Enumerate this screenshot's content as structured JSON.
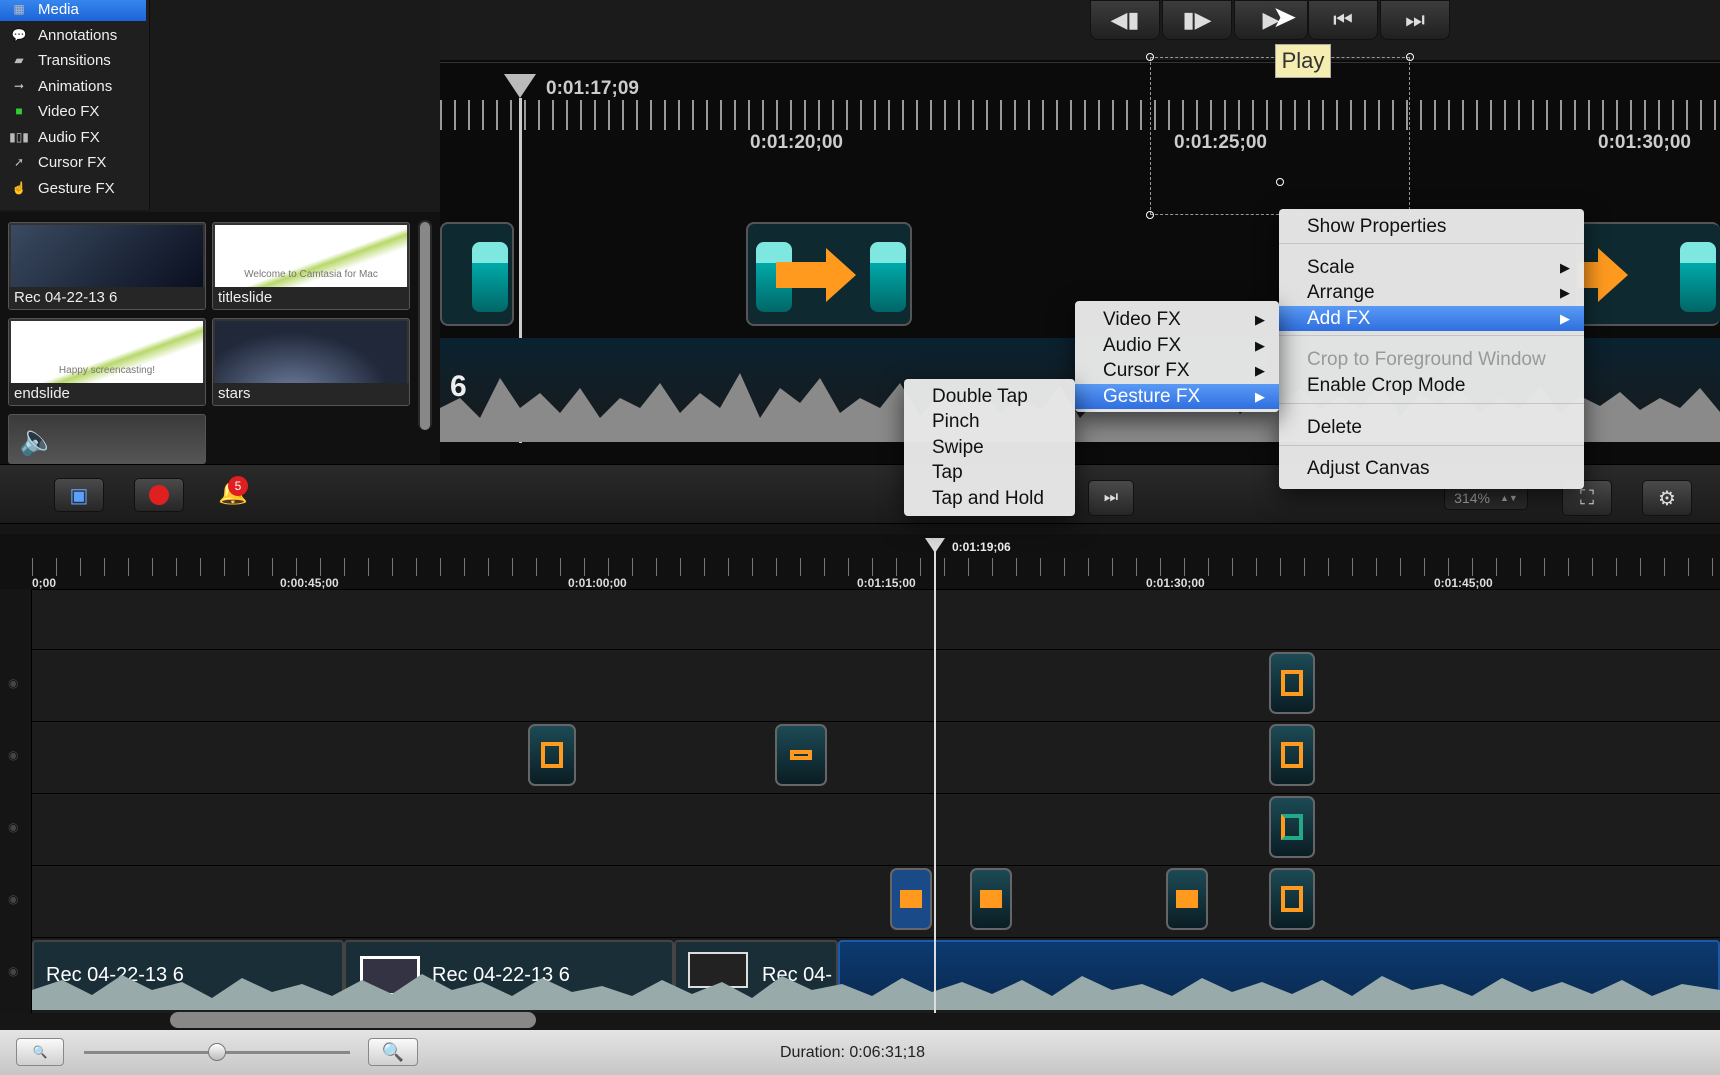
{
  "library": {
    "items": [
      {
        "label": "Media",
        "icon": "media-icon"
      },
      {
        "label": "Annotations",
        "icon": "annotations-icon"
      },
      {
        "label": "Transitions",
        "icon": "transitions-icon"
      },
      {
        "label": "Animations",
        "icon": "animations-icon"
      },
      {
        "label": "Video FX",
        "icon": "video-fx-icon"
      },
      {
        "label": "Audio FX",
        "icon": "audio-fx-icon"
      },
      {
        "label": "Cursor FX",
        "icon": "cursor-fx-icon"
      },
      {
        "label": "Gesture FX",
        "icon": "gesture-fx-icon"
      }
    ],
    "selected": "Media"
  },
  "bin": {
    "clips": [
      {
        "label": "Rec 04-22-13 6"
      },
      {
        "label": "titleslide",
        "text": "Welcome to Camtasia for Mac"
      },
      {
        "label": "endslide",
        "text": "Happy screencasting!"
      },
      {
        "label": "stars"
      }
    ]
  },
  "canvas": {
    "playhead_time": "0:01:17;09",
    "ruler_labels": [
      "0:01:20;00",
      "0:01:25;00",
      "0:01:30;00"
    ],
    "track_number": "6",
    "tooltip": "Play"
  },
  "toolbar": {
    "notification_count": "5",
    "zoom": "314%"
  },
  "context_menu": {
    "items": [
      {
        "label": "Show Properties"
      },
      {
        "label": "Scale",
        "sub": "▶"
      },
      {
        "label": "Arrange",
        "sub": "▶"
      },
      {
        "label": "Add FX",
        "sub": "▶"
      },
      {
        "label": "Crop to Foreground Window"
      },
      {
        "label": "Enable Crop Mode"
      },
      {
        "label": "Delete"
      },
      {
        "label": "Adjust Canvas"
      }
    ]
  },
  "fx_menu": {
    "items": [
      {
        "label": "Video FX",
        "sub": "▶"
      },
      {
        "label": "Audio FX",
        "sub": "▶"
      },
      {
        "label": "Cursor FX",
        "sub": "▶"
      },
      {
        "label": "Gesture FX",
        "sub": "▶"
      }
    ]
  },
  "gesture_menu": {
    "items": [
      {
        "label": "Double Tap"
      },
      {
        "label": "Pinch"
      },
      {
        "label": "Swipe"
      },
      {
        "label": "Tap"
      },
      {
        "label": "Tap and Hold"
      }
    ]
  },
  "timeline": {
    "playhead_time": "0:01:19;06",
    "ruler_labels": [
      "0;00",
      "0:00:45;00",
      "0:01:00;00",
      "0:01:15;00",
      "0:01:30;00",
      "0:01:45;00"
    ],
    "clips": [
      "Rec 04-22-13 6",
      "Rec 04-22-13 6",
      "Rec 04-"
    ]
  },
  "status": {
    "duration": "Duration: 0:06:31;18"
  },
  "colors": {
    "selection": "#2f6fe0",
    "accent_orange": "#ff9a1f",
    "record_red": "#e02020"
  }
}
